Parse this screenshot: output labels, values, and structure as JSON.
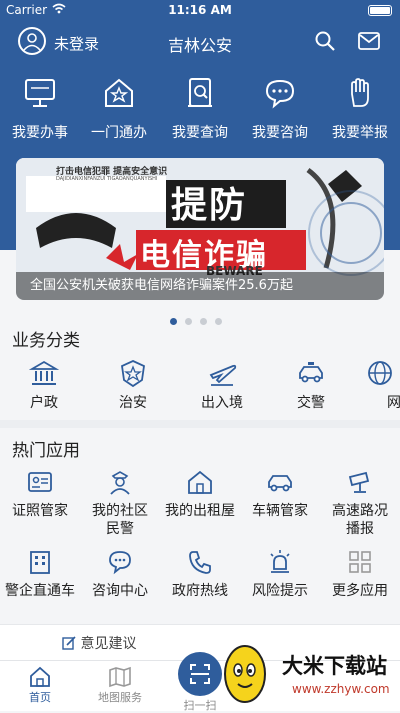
{
  "status": {
    "carrier": "Carrier",
    "time": "11:16 AM"
  },
  "header": {
    "login_text": "未登录",
    "title": "吉林公安"
  },
  "quick_actions": [
    {
      "label": "我要办事",
      "icon": "monitor-icon"
    },
    {
      "label": "一门通办",
      "icon": "house-icon"
    },
    {
      "label": "我要查询",
      "icon": "book-search-icon"
    },
    {
      "label": "我要咨询",
      "icon": "chat-icon"
    },
    {
      "label": "我要举报",
      "icon": "hand-icon"
    }
  ],
  "banner": {
    "slogan_small": "打击电信犯罪 提高安全意识",
    "pinyin": "DAJIDIANXINFANZUI TIGAOANQUANYISHI",
    "headline_1": "提防",
    "headline_2": "电信诈骗",
    "beware": "BEWARE",
    "caption": "全国公安机关破获电信网络诈骗案件25.6万起"
  },
  "carousel": {
    "count": 4,
    "active": 0
  },
  "categories_title": "业务分类",
  "categories": [
    {
      "label": "户政",
      "icon": "bank-icon"
    },
    {
      "label": "治安",
      "icon": "police-badge-icon"
    },
    {
      "label": "出入境",
      "icon": "airplane-icon"
    },
    {
      "label": "交警",
      "icon": "car-icon"
    },
    {
      "label": "网",
      "icon": "globe-icon"
    }
  ],
  "hot_title": "热门应用",
  "hot_apps": [
    {
      "label": "证照管家",
      "icon": "id-card-icon"
    },
    {
      "label": "我的社区民警",
      "icon": "police-officer-icon"
    },
    {
      "label": "我的出租屋",
      "icon": "rental-house-icon"
    },
    {
      "label": "车辆管家",
      "icon": "car-icon"
    },
    {
      "label": "高速路况播报",
      "icon": "camera-icon"
    },
    {
      "label": "警企直通车",
      "icon": "building-icon"
    },
    {
      "label": "咨询中心",
      "icon": "chat-icon"
    },
    {
      "label": "政府热线",
      "icon": "phone-icon"
    },
    {
      "label": "风险提示",
      "icon": "siren-icon"
    },
    {
      "label": "更多应用",
      "icon": "grid-icon"
    }
  ],
  "feedback": {
    "label": "意见建议"
  },
  "tabs": [
    {
      "label": "首页"
    },
    {
      "label": "地图服务"
    },
    {
      "label": "扫一扫"
    }
  ],
  "watermark": {
    "brand": "大米下载站",
    "url": "www.zzhyw.com"
  },
  "colors": {
    "primary": "#2f5d9c",
    "banner_red": "#d7262c",
    "background": "#f4f5f7"
  }
}
